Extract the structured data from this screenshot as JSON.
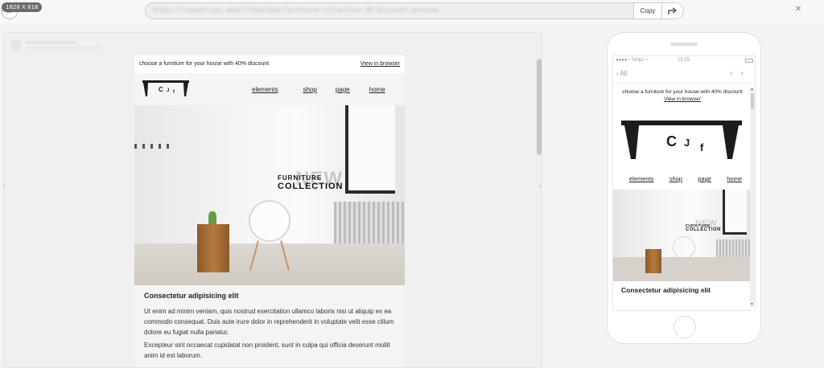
{
  "topbar": {
    "dimensions_badge": "1828 X 818",
    "url": "https://viewstripo.email/template/furniture-collection-40-discount-preview",
    "copy_label": "Copy"
  },
  "email": {
    "preheader_text": "choose a furniture for your house with 40% discount",
    "view_in_browser": "View in browser",
    "logo_letters": [
      "C",
      "J",
      "f"
    ],
    "nav": [
      "elements",
      "shop",
      "page",
      "home"
    ],
    "hero": {
      "overlay_new": "NEW",
      "line1": "FURNITURE",
      "line2": "COLLECTION"
    },
    "article": {
      "title": "Consectetur adipisicing elit",
      "p1": "Ut enim ad minim veniam, quis nostrud exercitation ullamco laboris nisi ut aliquip ex ea commodo consequat. Duis aute irure dolor in reprehenderit in voluptate velit esse cillum dolore eu fugiat nulla pariatur.",
      "p2": "Excepteur sint occaecat cupidatat non proident, sunt in culpa qui officia deserunt mollit anim id est laborum."
    }
  },
  "phone": {
    "carrier": "●●●●○ Stripo ≈",
    "time": "15:15",
    "back_label": "All",
    "title_truncated": "Consectetur adipisicing elit"
  },
  "colors": {
    "accent_orange": "#f5b98a",
    "logo_black": "#1c1c1c"
  }
}
